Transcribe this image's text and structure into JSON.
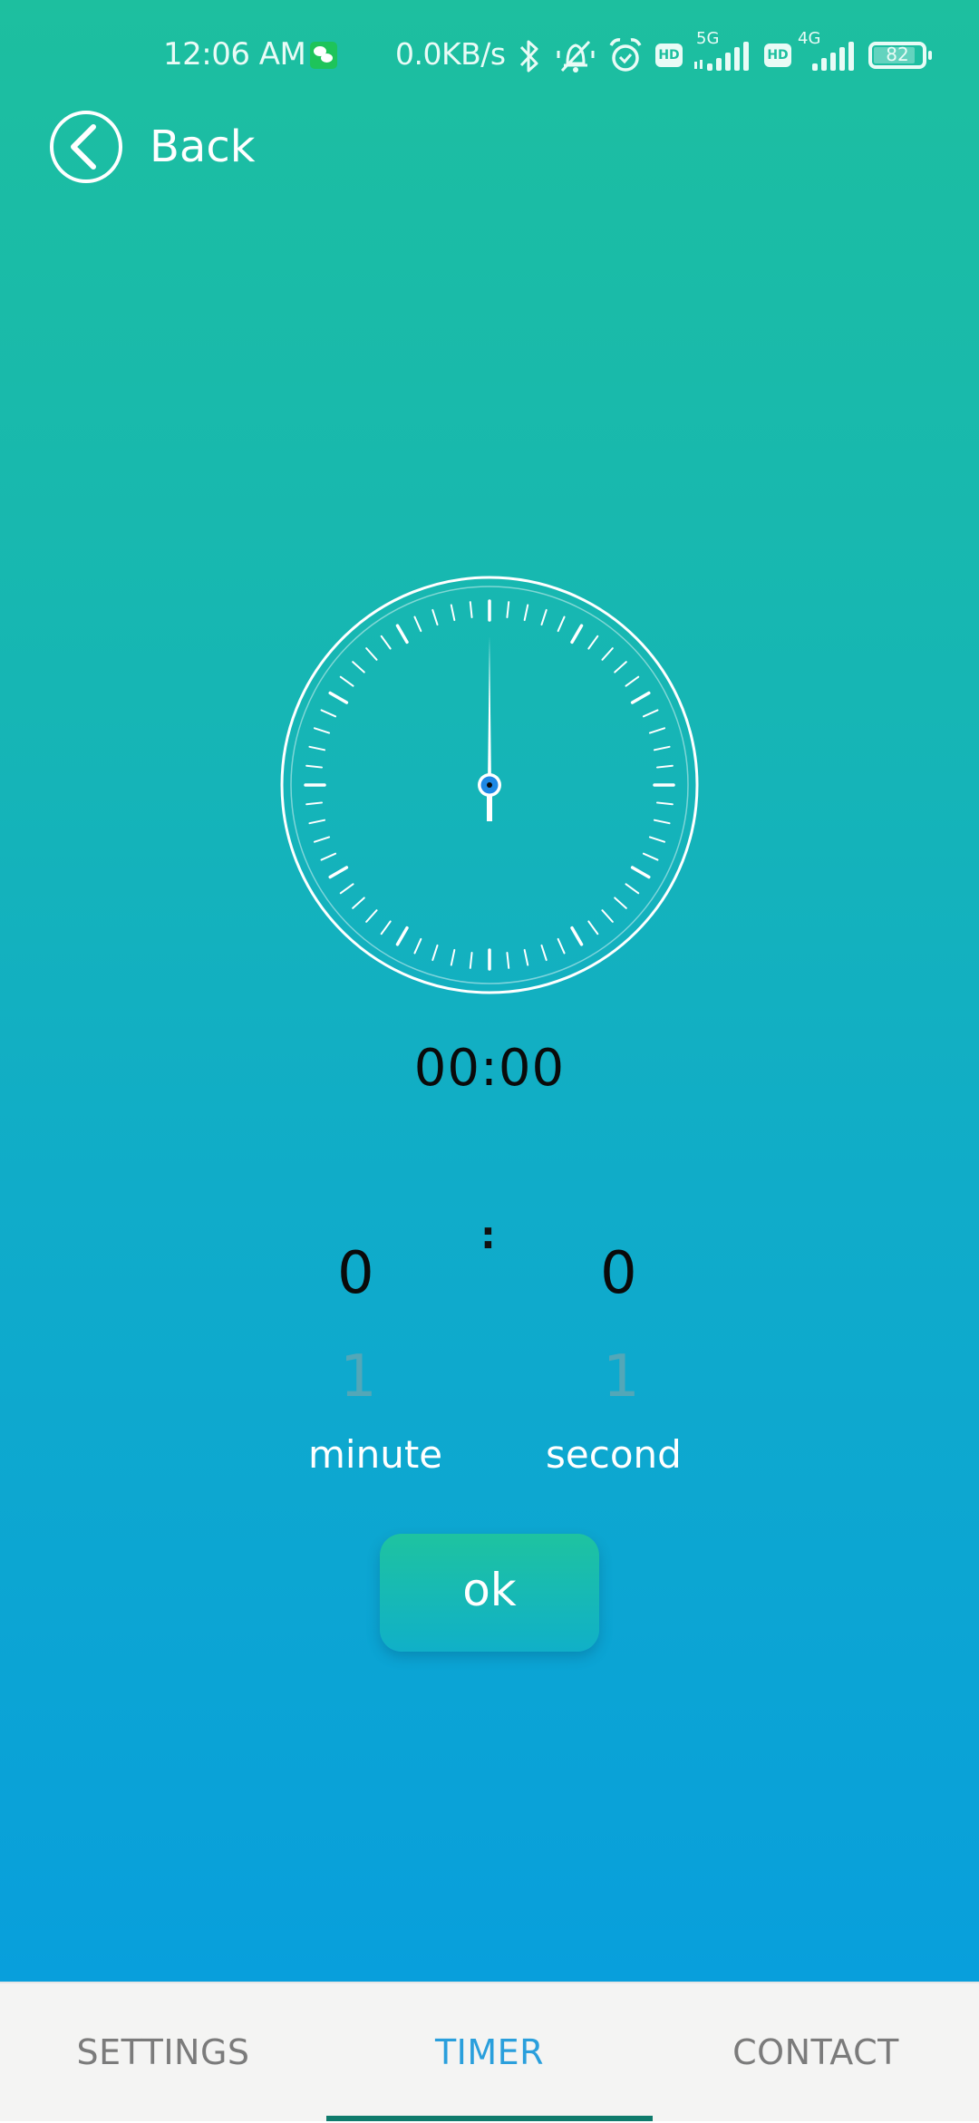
{
  "status_bar": {
    "time": "12:06 AM",
    "notification_icon": "wechat-icon",
    "net_speed": "0.0KB/s",
    "icons": [
      "bluetooth-icon",
      "vibrate-mute-icon",
      "alarm-icon",
      "hd-icon",
      "signal-5g-icon",
      "hd-icon",
      "signal-4g-icon"
    ],
    "network_1": "5G",
    "network_2": "4G",
    "hd_label": "HD",
    "battery": "82"
  },
  "header": {
    "back_label": "Back"
  },
  "timer": {
    "display": "00:00",
    "clock_hand_seconds": 0,
    "picker_separator": ":",
    "minute": {
      "value": "0",
      "next": "1",
      "label": "minute"
    },
    "second": {
      "value": "0",
      "next": "1",
      "label": "second"
    },
    "ok_label": "ok"
  },
  "tabs": [
    {
      "label": "SETTINGS",
      "active": false
    },
    {
      "label": "TIMER",
      "active": true
    },
    {
      "label": "CONTACT",
      "active": false
    }
  ],
  "colors": {
    "gradient_top": "#1dbf9f",
    "gradient_bottom": "#089fdc",
    "active_tab": "#2a9fdc",
    "tab_indicator": "#0f7b6c",
    "hub_blue": "#1e88e5"
  }
}
